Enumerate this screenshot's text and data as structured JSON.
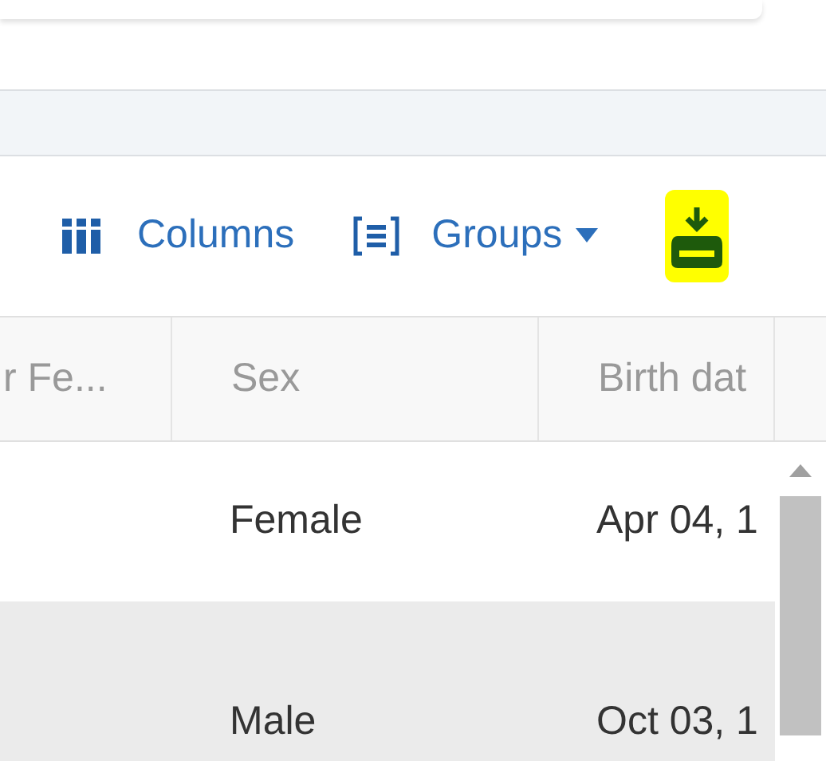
{
  "toolbar": {
    "columns_button": "Columns",
    "groups_button": "Groups"
  },
  "table": {
    "columns": [
      "r Fe...",
      "Sex",
      "Birth dat"
    ],
    "rows": [
      {
        "cells": [
          "",
          "Female",
          "Apr 04, 1"
        ],
        "selected": false
      },
      {
        "cells": [
          "",
          "Male",
          "Oct 03, 1"
        ],
        "selected": true
      }
    ]
  }
}
